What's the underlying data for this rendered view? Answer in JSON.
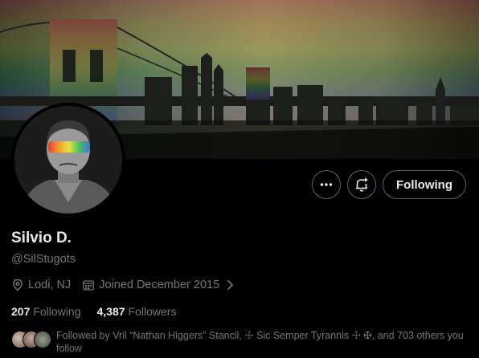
{
  "profile": {
    "name": "Silvio D.",
    "handle": "@SilStugots",
    "location": "Lodi, NJ",
    "joined": "Joined December 2015"
  },
  "actions": {
    "following_label": "Following"
  },
  "stats": {
    "following_count": "207",
    "following_label": "Following",
    "followers_count": "4,387",
    "followers_label": "Followers"
  },
  "followed_by": {
    "text": "Followed by Vril “Nathan Higgers” Stancil, ☩ Sic Semper Tyrannis ☩ ✠, and 703 others you follow"
  },
  "icons": {
    "more": "more-horizontal-icon",
    "notify": "notification-bell-plus-icon",
    "location": "location-pin-icon",
    "calendar": "calendar-icon",
    "chevron": "chevron-right-icon"
  },
  "colors": {
    "background": "#000000",
    "text_primary": "#e7e9ea",
    "text_secondary": "#71767b",
    "button_border": "#536471"
  }
}
